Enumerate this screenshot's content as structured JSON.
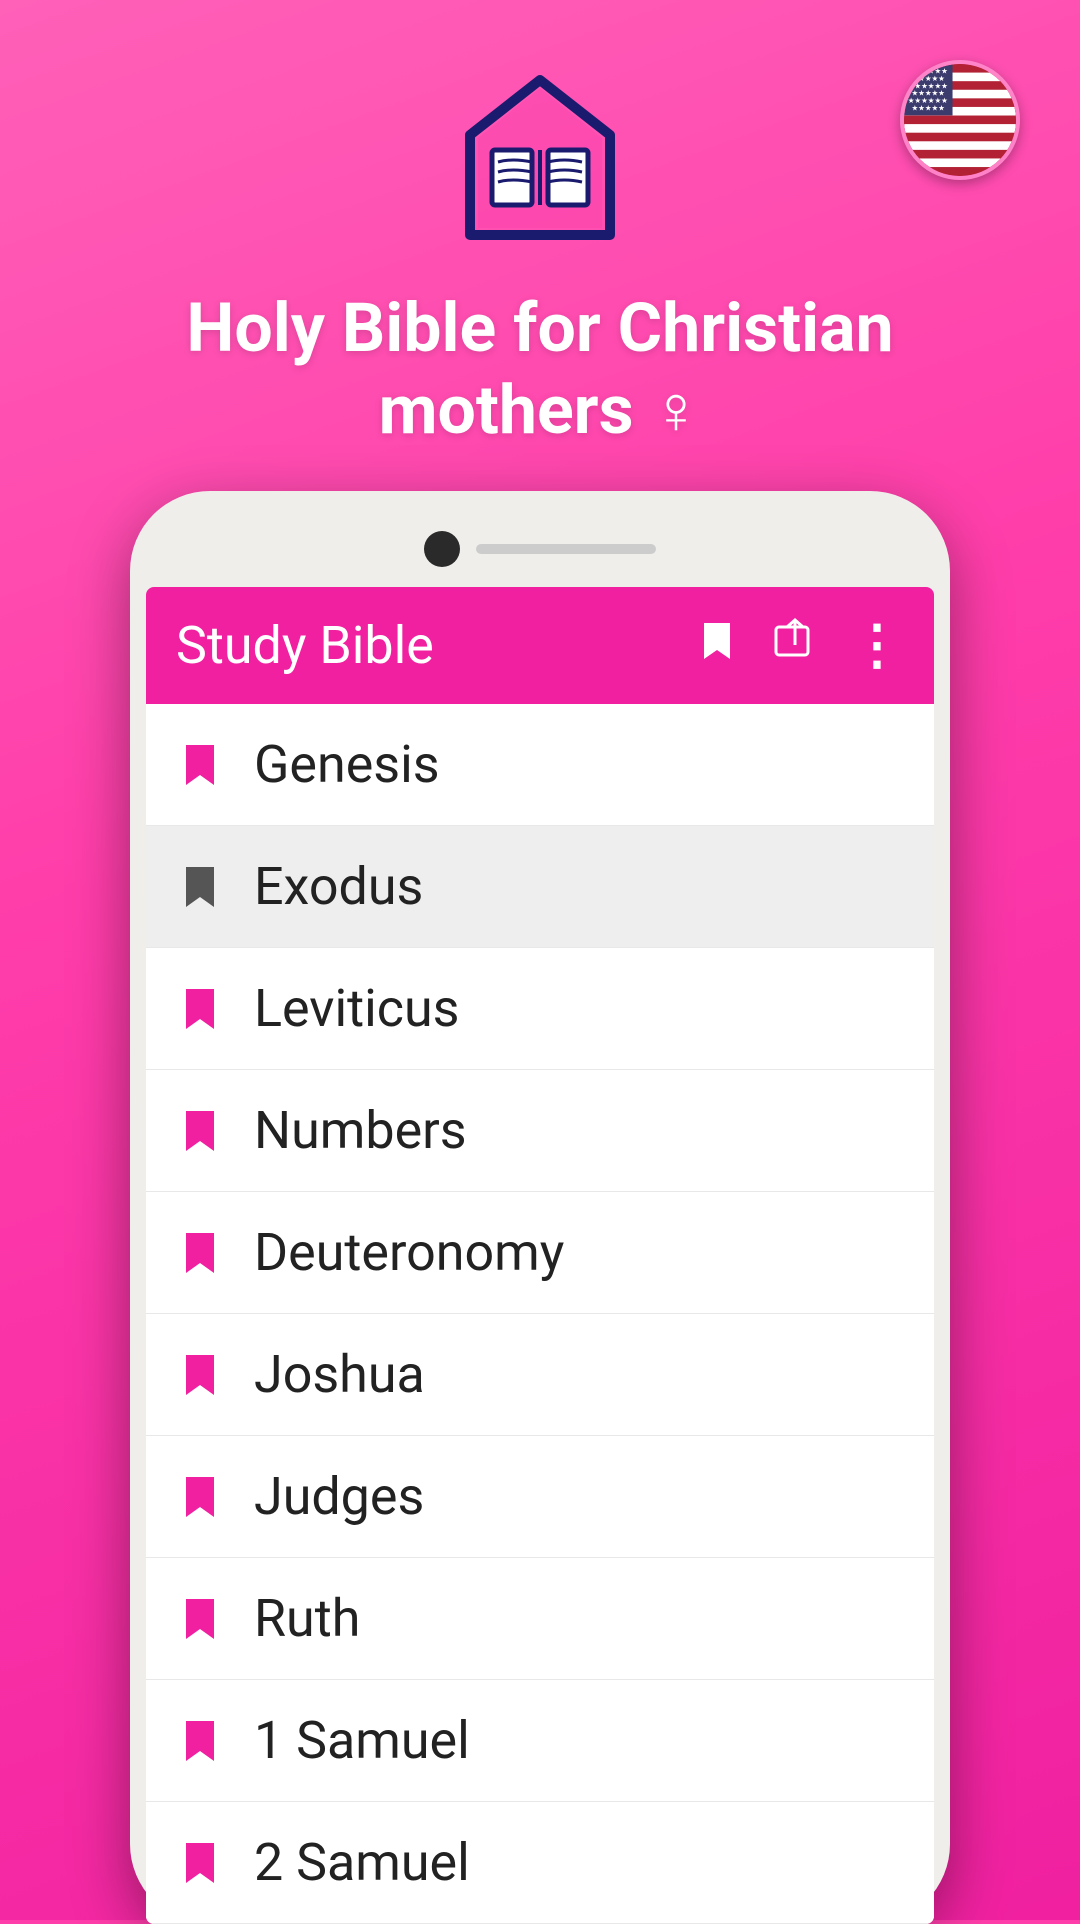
{
  "app": {
    "title": "Holy Bible for Christian mothers ♀",
    "title_line1": "Holy Bible for Christian",
    "title_line2": "mothers",
    "female_symbol": "♀"
  },
  "appbar": {
    "title": "Study Bible",
    "bookmark_icon": "🔖",
    "share_icon": "⬛",
    "more_icon": "⋮"
  },
  "flag": {
    "alt": "US Flag"
  },
  "bible_books": [
    {
      "name": "Genesis",
      "selected": false,
      "bookmark_style": "pink"
    },
    {
      "name": "Exodus",
      "selected": true,
      "bookmark_style": "dark"
    },
    {
      "name": "Leviticus",
      "selected": false,
      "bookmark_style": "pink"
    },
    {
      "name": "Numbers",
      "selected": false,
      "bookmark_style": "pink"
    },
    {
      "name": "Deuteronomy",
      "selected": false,
      "bookmark_style": "pink"
    },
    {
      "name": "Joshua",
      "selected": false,
      "bookmark_style": "pink"
    },
    {
      "name": "Judges",
      "selected": false,
      "bookmark_style": "pink"
    },
    {
      "name": "Ruth",
      "selected": false,
      "bookmark_style": "pink"
    },
    {
      "name": "1 Samuel",
      "selected": false,
      "bookmark_style": "pink"
    },
    {
      "name": "2 Samuel",
      "selected": false,
      "bookmark_style": "pink"
    }
  ]
}
